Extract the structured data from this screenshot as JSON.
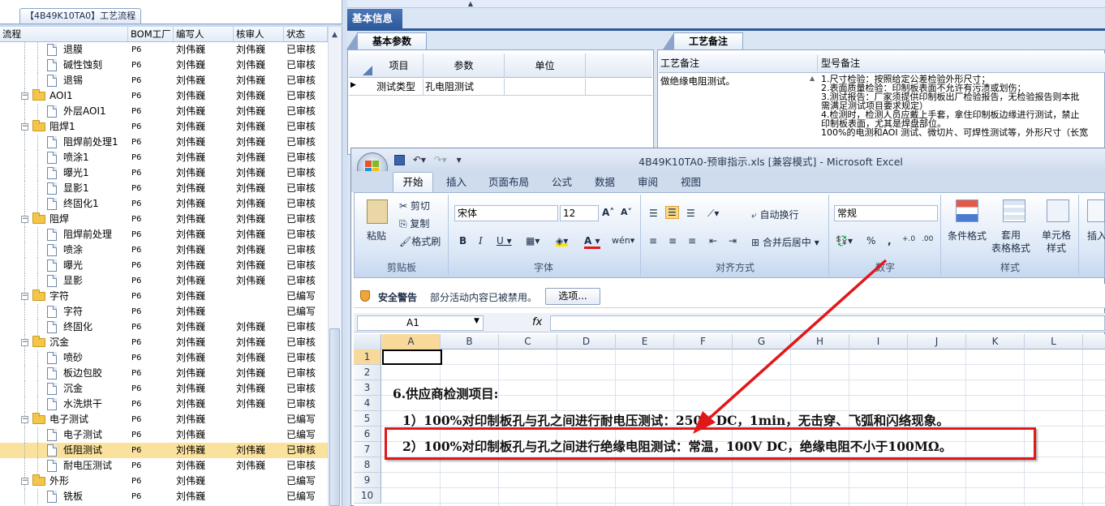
{
  "left_panel": {
    "tab_title": "【4B49K10TA0】工艺流程",
    "columns": [
      "流程",
      "BOM工厂",
      "编写人",
      "核审人",
      "状态"
    ],
    "rows": [
      {
        "level": 2,
        "type": "doc",
        "name": "退膜",
        "bom": "P6",
        "writer": "刘伟巍",
        "reviewer": "刘伟巍",
        "status": "已审核"
      },
      {
        "level": 2,
        "type": "doc",
        "name": "碱性蚀刻",
        "bom": "P6",
        "writer": "刘伟巍",
        "reviewer": "刘伟巍",
        "status": "已审核"
      },
      {
        "level": 2,
        "type": "doc",
        "name": "退锡",
        "bom": "P6",
        "writer": "刘伟巍",
        "reviewer": "刘伟巍",
        "status": "已审核"
      },
      {
        "level": 1,
        "type": "folder",
        "name": "AOI1",
        "bom": "P6",
        "writer": "刘伟巍",
        "reviewer": "刘伟巍",
        "status": "已审核"
      },
      {
        "level": 2,
        "type": "doc",
        "name": "外层AOI1",
        "bom": "P6",
        "writer": "刘伟巍",
        "reviewer": "刘伟巍",
        "status": "已审核"
      },
      {
        "level": 1,
        "type": "folder",
        "name": "阻焊1",
        "bom": "P6",
        "writer": "刘伟巍",
        "reviewer": "刘伟巍",
        "status": "已审核"
      },
      {
        "level": 2,
        "type": "doc",
        "name": "阻焊前处理1",
        "bom": "P6",
        "writer": "刘伟巍",
        "reviewer": "刘伟巍",
        "status": "已审核"
      },
      {
        "level": 2,
        "type": "doc",
        "name": "喷涂1",
        "bom": "P6",
        "writer": "刘伟巍",
        "reviewer": "刘伟巍",
        "status": "已审核"
      },
      {
        "level": 2,
        "type": "doc",
        "name": "曝光1",
        "bom": "P6",
        "writer": "刘伟巍",
        "reviewer": "刘伟巍",
        "status": "已审核"
      },
      {
        "level": 2,
        "type": "doc",
        "name": "显影1",
        "bom": "P6",
        "writer": "刘伟巍",
        "reviewer": "刘伟巍",
        "status": "已审核"
      },
      {
        "level": 2,
        "type": "doc",
        "name": "终固化1",
        "bom": "P6",
        "writer": "刘伟巍",
        "reviewer": "刘伟巍",
        "status": "已审核"
      },
      {
        "level": 1,
        "type": "folder",
        "name": "阻焊",
        "bom": "P6",
        "writer": "刘伟巍",
        "reviewer": "刘伟巍",
        "status": "已审核"
      },
      {
        "level": 2,
        "type": "doc",
        "name": "阻焊前处理",
        "bom": "P6",
        "writer": "刘伟巍",
        "reviewer": "刘伟巍",
        "status": "已审核"
      },
      {
        "level": 2,
        "type": "doc",
        "name": "喷涂",
        "bom": "P6",
        "writer": "刘伟巍",
        "reviewer": "刘伟巍",
        "status": "已审核"
      },
      {
        "level": 2,
        "type": "doc",
        "name": "曝光",
        "bom": "P6",
        "writer": "刘伟巍",
        "reviewer": "刘伟巍",
        "status": "已审核"
      },
      {
        "level": 2,
        "type": "doc",
        "name": "显影",
        "bom": "P6",
        "writer": "刘伟巍",
        "reviewer": "刘伟巍",
        "status": "已审核"
      },
      {
        "level": 1,
        "type": "folder",
        "name": "字符",
        "bom": "P6",
        "writer": "刘伟巍",
        "reviewer": "",
        "status": "已编写"
      },
      {
        "level": 2,
        "type": "doc",
        "name": "字符",
        "bom": "P6",
        "writer": "刘伟巍",
        "reviewer": "",
        "status": "已编写"
      },
      {
        "level": 2,
        "type": "doc",
        "name": "终固化",
        "bom": "P6",
        "writer": "刘伟巍",
        "reviewer": "刘伟巍",
        "status": "已审核"
      },
      {
        "level": 1,
        "type": "folder",
        "name": "沉金",
        "bom": "P6",
        "writer": "刘伟巍",
        "reviewer": "刘伟巍",
        "status": "已审核"
      },
      {
        "level": 2,
        "type": "doc",
        "name": "喷砂",
        "bom": "P6",
        "writer": "刘伟巍",
        "reviewer": "刘伟巍",
        "status": "已审核"
      },
      {
        "level": 2,
        "type": "doc",
        "name": "板边包胶",
        "bom": "P6",
        "writer": "刘伟巍",
        "reviewer": "刘伟巍",
        "status": "已审核"
      },
      {
        "level": 2,
        "type": "doc",
        "name": "沉金",
        "bom": "P6",
        "writer": "刘伟巍",
        "reviewer": "刘伟巍",
        "status": "已审核"
      },
      {
        "level": 2,
        "type": "doc",
        "name": "水洗烘干",
        "bom": "P6",
        "writer": "刘伟巍",
        "reviewer": "刘伟巍",
        "status": "已审核"
      },
      {
        "level": 1,
        "type": "folder",
        "name": "电子测试",
        "bom": "P6",
        "writer": "刘伟巍",
        "reviewer": "",
        "status": "已编写"
      },
      {
        "level": 2,
        "type": "doc",
        "name": "电子测试",
        "bom": "P6",
        "writer": "刘伟巍",
        "reviewer": "",
        "status": "已编写"
      },
      {
        "level": 2,
        "type": "doc",
        "name": "低阻测试",
        "bom": "P6",
        "writer": "刘伟巍",
        "reviewer": "刘伟巍",
        "status": "已审核",
        "selected": true
      },
      {
        "level": 2,
        "type": "doc",
        "name": "耐电压测试",
        "bom": "P6",
        "writer": "刘伟巍",
        "reviewer": "刘伟巍",
        "status": "已审核"
      },
      {
        "level": 1,
        "type": "folder",
        "name": "外形",
        "bom": "P6",
        "writer": "刘伟巍",
        "reviewer": "",
        "status": "已编写"
      },
      {
        "level": 2,
        "type": "doc",
        "name": "铣板",
        "bom": "P6",
        "writer": "刘伟巍",
        "reviewer": "",
        "status": "已编写"
      }
    ]
  },
  "info_panel": {
    "main_tab": "基本信息",
    "param_tab": "基本参数",
    "remark_tab": "工艺备注",
    "param_headers": [
      "项目",
      "参数",
      "单位"
    ],
    "param_row": {
      "item": "测试类型",
      "value": "孔电阻测试",
      "unit": ""
    },
    "remark_headers": [
      "工艺备注",
      "型号备注"
    ],
    "remark_text": "做绝缘电阻测试。",
    "model_remark": "1.尺寸检验：按照给定公差检验外形尺寸；\n2.表面质量检验：印制板表面不允许有污渍或划伤；\n3.测试报告：厂家须提供印制板出厂检验报告，无检验报告则本批\n需满足测试项目要求规定）\n4.检测时，检测人员应戴上手套，拿住印制板边缘进行测试，禁止\n印制板表面，尤其是焊盘部位。\n100%的电测和AOI 测试、微切片、可焊性测试等，外形尺寸（长宽"
  },
  "excel": {
    "title": "4B49K10TA0-预审指示.xls  [兼容模式] - Microsoft Excel",
    "ribbon_tabs": [
      "开始",
      "插入",
      "页面布局",
      "公式",
      "数据",
      "审阅",
      "视图"
    ],
    "clipboard": {
      "paste": "粘贴",
      "cut": "剪切",
      "copy": "复制",
      "format_painter": "格式刷",
      "label": "剪贴板"
    },
    "font": {
      "name": "宋体",
      "size": "12",
      "label": "字体"
    },
    "alignment": {
      "wrap": "自动换行",
      "merge": "合并后居中",
      "label": "对齐方式"
    },
    "number": {
      "format": "常规",
      "percent": "%",
      "comma": ",",
      "label": "数字"
    },
    "styles": {
      "conditional": "条件格式",
      "table": "套用\n表格格式",
      "cell": "单元格\n样式",
      "label": "样式"
    },
    "insert": "插入",
    "security_title": "安全警告",
    "security_msg": "部分活动内容已被禁用。",
    "options_button": "选项...",
    "name_box": "A1",
    "fx": "fx",
    "columns": [
      "A",
      "B",
      "C",
      "D",
      "E",
      "F",
      "G",
      "H",
      "I",
      "J",
      "K",
      "L"
    ],
    "rows": [
      "1",
      "2",
      "3",
      "4",
      "5",
      "6",
      "7",
      "8",
      "9",
      "10"
    ],
    "line3": "6.供应商检测项目:",
    "line5": "1）100%对印制板孔与孔之间进行耐电压测试：250V DC，1min，无击穿、飞弧和闪络现象。",
    "line7": "2）100%对印制板孔与孔之间进行绝缘电阻测试：常温，100V DC，绝缘电阻不小于100MΩ。"
  },
  "colors": {
    "accent": "#2d5a9c",
    "annotation": "#e01818",
    "selected_row": "#fbe29c"
  }
}
